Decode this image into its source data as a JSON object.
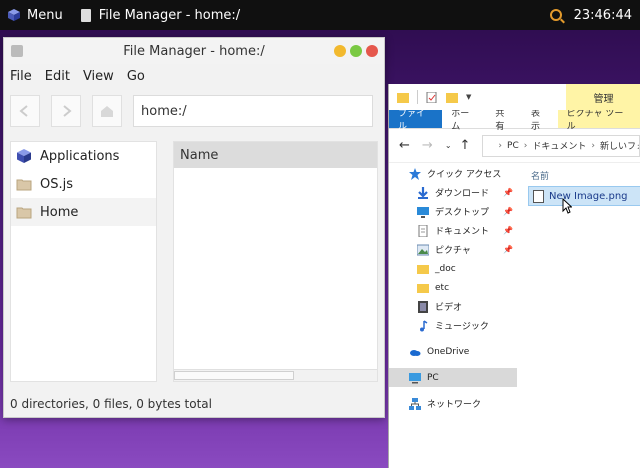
{
  "panel": {
    "menu_label": "Menu",
    "task_label": "File Manager - home:/",
    "clock": "23:46:44"
  },
  "file_manager": {
    "title": "File Manager - home:/",
    "menu": [
      "File",
      "Edit",
      "View",
      "Go"
    ],
    "address": "home:/",
    "sidebar": [
      {
        "label": "Applications",
        "icon": "applications-icon"
      },
      {
        "label": "OS.js",
        "icon": "folder-icon"
      },
      {
        "label": "Home",
        "icon": "folder-icon"
      }
    ],
    "column_name": "Name",
    "status": "0 directories, 0 files, 0 bytes total"
  },
  "explorer": {
    "manage_tab": "管理",
    "ribbon_tabs": [
      "ファイル",
      "ホーム",
      "共有",
      "表示",
      "ピクチャ ツール"
    ],
    "path": [
      "PC",
      "ドキュメント",
      "新しいフォル"
    ],
    "nav_items": {
      "quick_access": "クイック アクセス",
      "downloads": "ダウンロード",
      "desktop": "デスクトップ",
      "documents": "ドキュメント",
      "pictures": "ピクチャ",
      "doc": "_doc",
      "etc": "etc",
      "videos": "ビデオ",
      "music": "ミュージック",
      "onedrive": "OneDrive",
      "pc": "PC",
      "network": "ネットワーク"
    },
    "column_name": "名前",
    "file_name": "New Image.png"
  },
  "colors": {
    "accent_blue": "#1a73c8",
    "tools_yellow": "#fff4a6",
    "selection_blue": "#cce4f7"
  }
}
